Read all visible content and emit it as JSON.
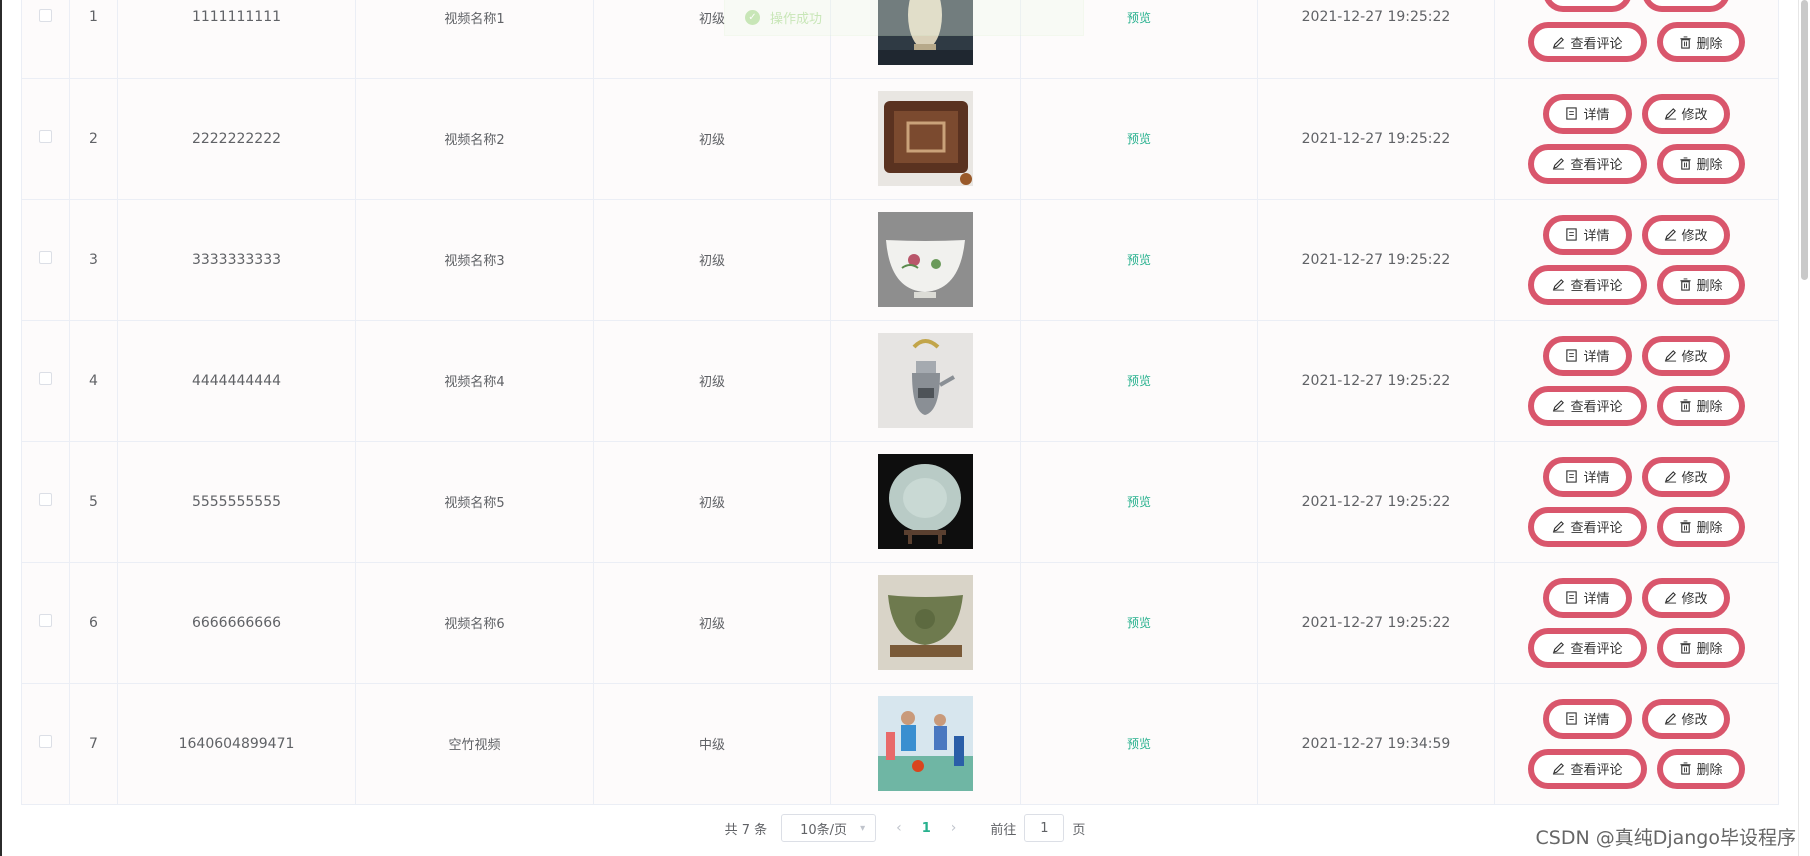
{
  "toast": {
    "text": "操作成功"
  },
  "table": {
    "preview_label": "预览",
    "actions": {
      "detail": "详情",
      "edit": "修改",
      "comments": "查看评论",
      "delete": "删除"
    },
    "rows": [
      {
        "index": "1",
        "code": "1111111111",
        "name": "视频名称1",
        "level": "初级",
        "time": "2021-12-27 19:25:22",
        "image": "white-vase"
      },
      {
        "index": "2",
        "code": "2222222222",
        "name": "视频名称2",
        "level": "初级",
        "time": "2021-12-27 19:25:22",
        "image": "carved-wooden-tray"
      },
      {
        "index": "3",
        "code": "3333333333",
        "name": "视频名称3",
        "level": "初级",
        "time": "2021-12-27 19:25:22",
        "image": "floral-porcelain-bowl"
      },
      {
        "index": "4",
        "code": "4444444444",
        "name": "视频名称4",
        "level": "初级",
        "time": "2021-12-27 19:25:22",
        "image": "silver-teapot"
      },
      {
        "index": "5",
        "code": "5555555555",
        "name": "视频名称5",
        "level": "初级",
        "time": "2021-12-27 19:25:22",
        "image": "celadon-plate"
      },
      {
        "index": "6",
        "code": "6666666666",
        "name": "视频名称6",
        "level": "初级",
        "time": "2021-12-27 19:25:22",
        "image": "green-glazed-bowl"
      },
      {
        "index": "7",
        "code": "1640604899471",
        "name": "空竹视频",
        "level": "中级",
        "time": "2021-12-27 19:34:59",
        "image": "diabolo-children-photo"
      }
    ]
  },
  "pagination": {
    "total_text": "共 7 条",
    "page_size": "10条/页",
    "current_page": "1",
    "goto_label": "前往",
    "goto_value": "1",
    "page_suffix": "页"
  },
  "watermark": "CSDN @真纯Django毕设程序",
  "colors": {
    "accent": "#27b18e",
    "button_border": "#d9566c",
    "toast": "#67c23a"
  }
}
